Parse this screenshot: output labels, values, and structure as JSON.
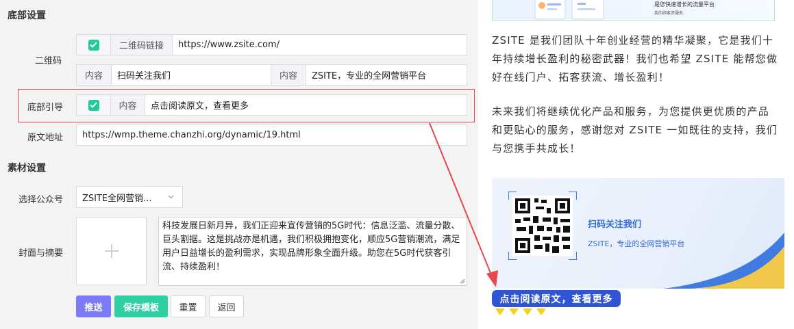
{
  "sections": {
    "footer_settings": "底部设置",
    "material_settings": "素材设置"
  },
  "qrcode": {
    "label": "二维码",
    "enabled": true,
    "link_addon": "二维码链接",
    "link_value": "https://www.zsite.com/",
    "content_addon_1": "内容",
    "content_value_1": "扫码关注我们",
    "content_addon_2": "内容",
    "content_value_2": "ZSITE，专业的全网营销平台"
  },
  "footer_guide": {
    "label": "底部引导",
    "enabled": true,
    "content_addon": "内容",
    "content_value": "点击阅读原文，查看更多"
  },
  "source_url": {
    "label": "原文地址",
    "value": "https://wmp.theme.chanzhi.org/dynamic/19.html"
  },
  "account": {
    "label": "选择公众号",
    "selected": "ZSITE全网营销..."
  },
  "cover": {
    "label": "封面与摘要",
    "summary": "科技发展日新月异，我们正迎来宣传营销的5G时代：信息泛滥、流量分散、巨头割据。这是挑战亦是机遇，我们积极拥抱变化，顺应5G营销潮流，满足用户日益增长的盈利需求，实现品牌形象全面升级。助您在5G时代获客引流、持续盈利！"
  },
  "buttons": {
    "push": "推送",
    "save_template": "保存模板",
    "reset": "重置",
    "back": "返回"
  },
  "preview": {
    "banner_line_1": "是您快速增长的流量平台",
    "banner_line_2": "我的顾客资服务",
    "paragraph_1": "ZSITE 是我们团队十年创业经营的精华凝聚，它是我们十年持续增长盈利的秘密武器！我们也希望 ZSITE 能帮您做好在线门户、拓客获流、增长盈利！",
    "paragraph_2": "未来我们将继续优化产品和服务，为您提供更优质的产品和更贴心的服务，感谢您对 ZSITE 一如既往的支持，我们与您携手共成长！",
    "qr_title": "扫码关注我们",
    "qr_subtitle": "ZSITE，专业的全网营销平台",
    "read_more": "点击阅读原文，查看更多"
  },
  "colors": {
    "checkbox": "#20c997",
    "primary_button": "#7b7bf6",
    "success_button": "#2fd1a4",
    "highlight_border": "#e5484d",
    "read_more_bg": "#2f55d4",
    "qr_text": "#2f6bdc",
    "triangle": "#f2d21b"
  }
}
